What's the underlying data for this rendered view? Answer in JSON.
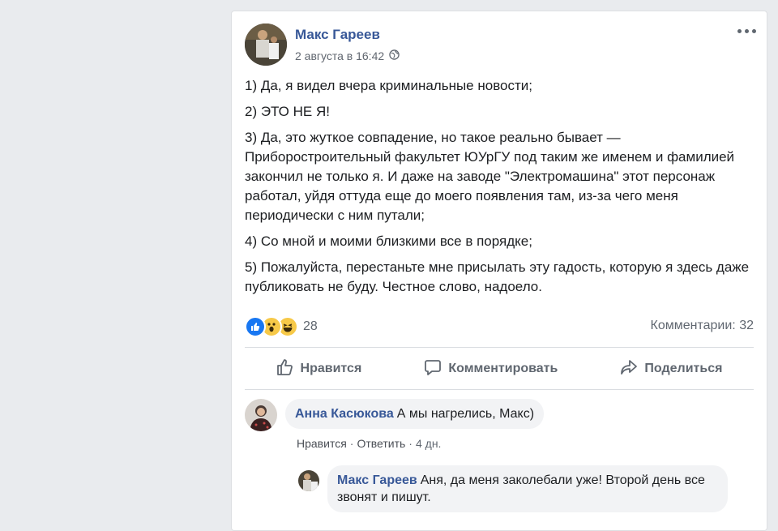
{
  "post": {
    "author": "Макс Гареев",
    "timestamp": "2 августа в 16:42",
    "privacy_icon": "globe-icon",
    "paragraphs": [
      "1) Да, я видел вчера криминальные новости;",
      "2) ЭТО НЕ Я!",
      "3) Да, это жуткое совпадение, но такое реально бывает — Приборостроительный факультет ЮУрГУ под таким же именем и фамилией закончил не только я. И даже на заводе \"Электромашина\" этот персонаж работал, уйдя оттуда еще до моего появления там, из-за чего меня периодически с ним путали;",
      "4) Со мной и моими близкими все в порядке;",
      "5) Пожалуйста, перестаньте мне присылать эту гадость, которую я здесь даже публиковать не буду. Честное слово, надоело."
    ],
    "reaction_count": "28",
    "reactions": [
      "like",
      "wow",
      "haha"
    ],
    "comments_count": "Комментарии: 32"
  },
  "actions": {
    "like": "Нравится",
    "comment": "Комментировать",
    "share": "Поделиться"
  },
  "comments": [
    {
      "author": "Анна Касюкова",
      "text": "А мы нагрелись, Макс)",
      "like_label": "Нравится",
      "reply_label": "Ответить",
      "age": "4 дн."
    }
  ],
  "reply": {
    "author": "Макс Гареев",
    "text": "Аня, да меня заколебали уже! Второй день все звонят и пишут."
  },
  "colors": {
    "link": "#385898",
    "like_blue": "#1877f2",
    "emoji_yellow": "#f7c948"
  }
}
